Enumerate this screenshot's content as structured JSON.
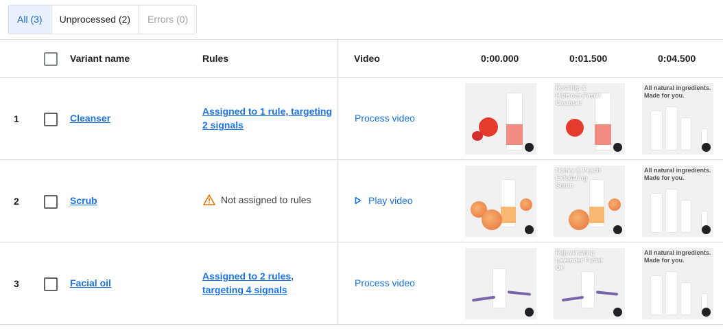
{
  "filters": [
    {
      "label": "All (3)",
      "state": "active"
    },
    {
      "label": "Unprocessed (2)",
      "state": "normal"
    },
    {
      "label": "Errors (0)",
      "state": "disabled"
    }
  ],
  "table": {
    "headers": {
      "variant_name": "Variant name",
      "rules": "Rules",
      "video": "Video",
      "t0": "0:00.000",
      "t1": "0:01.500",
      "t2": "0:04.500"
    },
    "rows": [
      {
        "num": "1",
        "variant": "Cleanser",
        "rules": "Assigned to 1 rule, targeting 2 signals",
        "video_action": "Process video",
        "frame2_text": "Rosehip & Hibiscus Facial Cleanser",
        "frame3_text": "All natural ingredients. Made for you."
      },
      {
        "num": "2",
        "variant": "Scrub",
        "rules": "Not assigned to rules",
        "video_action": "Play video",
        "frame2_text": "Honey & Peach Exfoliating Scrub",
        "frame3_text": "All natural ingredients. Made for you."
      },
      {
        "num": "3",
        "variant": "Facial oil",
        "rules": "Assigned to 2 rules, targeting 4 signals",
        "video_action": "Process video",
        "frame2_text": "Rejuvenating Lavender Facial Oil",
        "frame3_text": "All natural ingredients. Made for you."
      }
    ]
  },
  "icons": {
    "warning": "warning-icon",
    "play": "play-icon"
  },
  "colors": {
    "accent": "#1a73e8",
    "active_tab_bg": "#e8f0fe",
    "warning": "#e37400"
  }
}
